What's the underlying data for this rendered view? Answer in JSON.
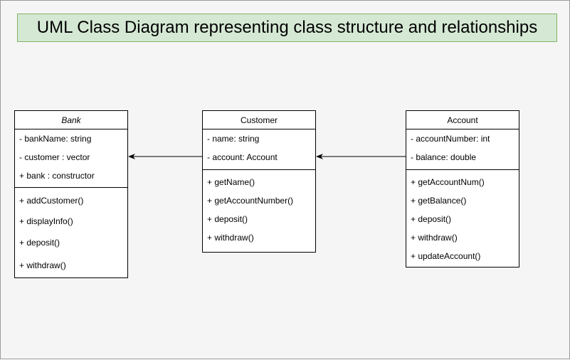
{
  "title": "UML Class Diagram representing class structure and relationships",
  "classes": {
    "bank": {
      "name": "Bank",
      "attributes": [
        "- bankName: string",
        "- customer : vector",
        "+ bank : constructor"
      ],
      "methods": [
        "+ addCustomer()",
        "+ displayInfo()",
        "+ deposit()",
        "+ withdraw()"
      ]
    },
    "customer": {
      "name": "Customer",
      "attributes": [
        "- name: string",
        "- account: Account"
      ],
      "methods": [
        "+ getName()",
        "+ getAccountNumber()",
        "+ deposit()",
        "+ withdraw()"
      ]
    },
    "account": {
      "name": "Account",
      "attributes": [
        "- accountNumber: int",
        "- balance: double"
      ],
      "methods": [
        "+ getAccountNum()",
        "+ getBalance()",
        "+ deposit()",
        "+ withdraw()",
        "+ updateAccount()"
      ]
    }
  },
  "colors": {
    "background": "#f5f5f5",
    "title_fill": "#d5e8d4",
    "title_stroke": "#82b366",
    "class_fill": "#ffffff",
    "line": "#000000"
  }
}
